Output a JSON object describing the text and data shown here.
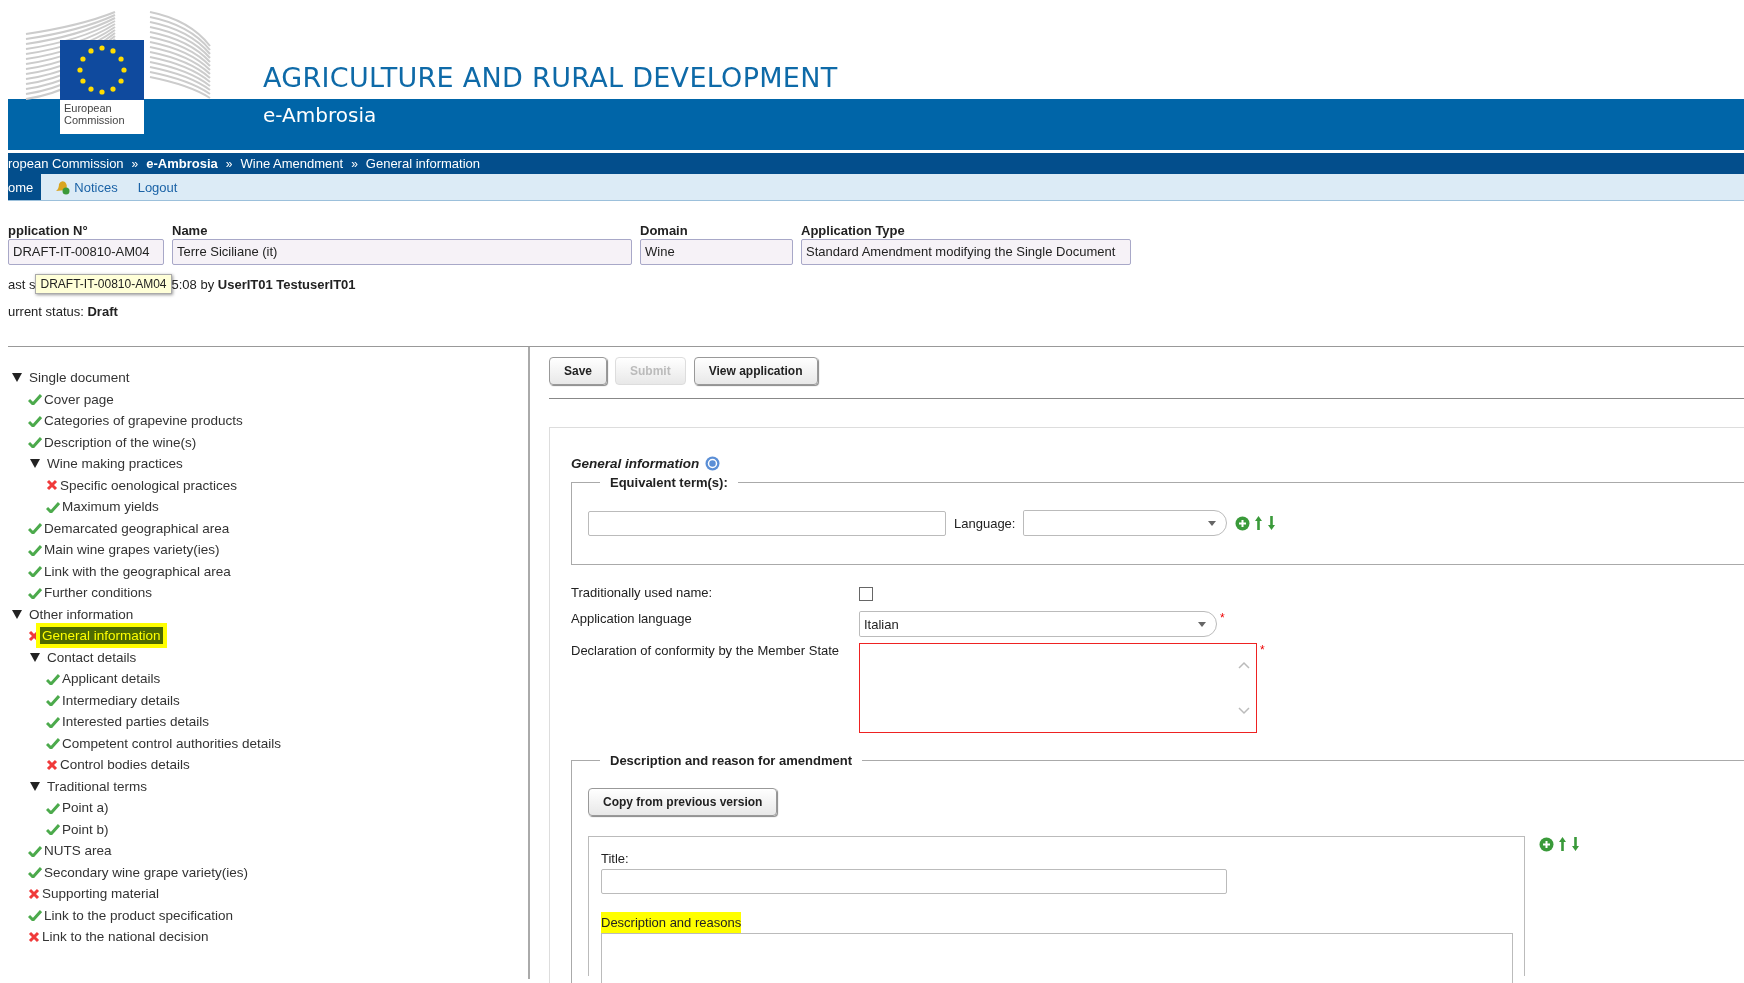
{
  "header": {
    "logo_text": "European Commission",
    "title": "AGRICULTURE AND RURAL DEVELOPMENT",
    "subtitle": "e-Ambrosia"
  },
  "breadcrumb": [
    {
      "label": "ropean Commission",
      "bold": false
    },
    {
      "label": "e-Ambrosia",
      "bold": true
    },
    {
      "label": "Wine Amendment",
      "bold": false
    },
    {
      "label": "General information",
      "bold": false
    }
  ],
  "breadcrumb_separator": "»",
  "nav": [
    {
      "label": "ome",
      "selected": true,
      "icon": false
    },
    {
      "label": "Notices",
      "selected": false,
      "icon": true
    },
    {
      "label": "Logout",
      "selected": false,
      "icon": false
    }
  ],
  "application_fields": [
    {
      "label": "pplication N°",
      "value": "DRAFT-IT-00810-AM04"
    },
    {
      "label": "Name",
      "value": "Terre Siciliane (it)"
    },
    {
      "label": "Domain",
      "value": "Wine"
    },
    {
      "label": "Application Type",
      "value": "Standard Amendment modifying the Single Document"
    }
  ],
  "last_saved": {
    "before": "ast s",
    "after": "5:08 by **UserIT01 TestuserIT01**",
    "tooltip": "DRAFT-IT-00810-AM04"
  },
  "current_status": "urrent status: **Draft**",
  "tree": [
    {
      "label": "Single document",
      "expanded": true,
      "selected": false,
      "children": [
        {
          "label": "Cover page",
          "complete": true,
          "selected": false
        },
        {
          "label": "Categories of grapevine products",
          "complete": true,
          "selected": false
        },
        {
          "label": "Description of the wine(s)",
          "complete": true,
          "selected": false
        },
        {
          "label": "Wine making practices",
          "expanded": true,
          "selected": false,
          "children": [
            {
              "label": "Specific oenological practices",
              "complete": false,
              "selected": false
            },
            {
              "label": "Maximum yields",
              "complete": true,
              "selected": false
            }
          ]
        },
        {
          "label": "Demarcated geographical area",
          "complete": true,
          "selected": false
        },
        {
          "label": "Main wine grapes variety(ies)",
          "complete": true,
          "selected": false
        },
        {
          "label": "Link with the geographical area",
          "complete": true,
          "selected": false
        },
        {
          "label": "Further conditions",
          "complete": true,
          "selected": false
        }
      ]
    },
    {
      "label": "Other information",
      "expanded": true,
      "selected": false,
      "children": [
        {
          "label": "General information",
          "complete": false,
          "selected": true
        },
        {
          "label": "Contact details",
          "expanded": true,
          "selected": false,
          "children": [
            {
              "label": "Applicant details",
              "complete": true,
              "selected": false
            },
            {
              "label": "Intermediary details",
              "complete": true,
              "selected": false
            },
            {
              "label": "Interested parties details",
              "complete": true,
              "selected": false
            },
            {
              "label": "Competent control authorities details",
              "complete": true,
              "selected": false
            },
            {
              "label": "Control bodies details",
              "complete": false,
              "selected": false
            }
          ]
        },
        {
          "label": "Traditional terms",
          "expanded": true,
          "selected": false,
          "children": [
            {
              "label": "Point a)",
              "complete": true,
              "selected": false
            },
            {
              "label": "Point b)",
              "complete": true,
              "selected": false
            }
          ]
        },
        {
          "label": "NUTS area",
          "complete": true,
          "selected": false
        },
        {
          "label": "Secondary wine grape variety(ies)",
          "complete": true,
          "selected": false
        },
        {
          "label": "Supporting material",
          "complete": false,
          "selected": false
        },
        {
          "label": "Link to the product specification",
          "complete": true,
          "selected": false
        },
        {
          "label": "Link to the national decision",
          "complete": false,
          "selected": false
        }
      ]
    }
  ],
  "toolbar": [
    {
      "label": "Save",
      "disabled": false
    },
    {
      "label": "Submit",
      "disabled": true
    },
    {
      "label": "View application",
      "disabled": false
    }
  ],
  "form": {
    "title": "General information",
    "equivalent_terms": {
      "legend": "Equivalent term(s):",
      "language_label": "Language:"
    },
    "traditionally_used_name": {
      "label": "Traditionally used name:",
      "checked": false
    },
    "application_language": {
      "label": "Application language",
      "value": "Italian",
      "required_mark": "*"
    },
    "declaration": {
      "label": "Declaration of conformity by the Member State",
      "required_mark": "*",
      "invalid": true
    },
    "amendment": {
      "legend": "Description and reason for amendment",
      "copy_button": "Copy from previous version",
      "title_label": "Title:",
      "description_label": "Description and reasons",
      "description_highlighted": true
    }
  }
}
